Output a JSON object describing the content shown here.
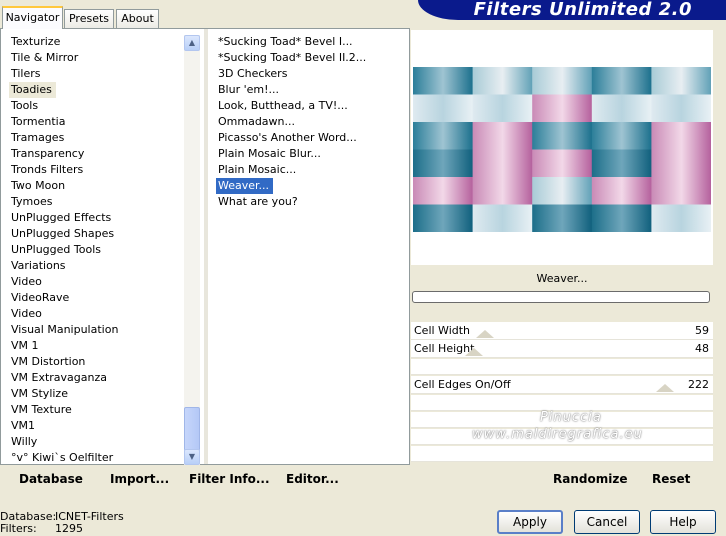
{
  "tabs": [
    {
      "label": "Navigator",
      "active": true
    },
    {
      "label": "Presets",
      "active": false
    },
    {
      "label": "About",
      "active": false
    }
  ],
  "banner": {
    "title": "Filters Unlimited 2.0",
    "color": "#0a1a8c"
  },
  "categories": {
    "items": [
      "Texturize",
      "Tile & Mirror",
      "Tilers",
      "Toadies",
      "Tools",
      "Tormentia",
      "Tramages",
      "Transparency",
      "Tronds Filters",
      "Two Moon",
      "Tymoes",
      "UnPlugged Effects",
      "UnPlugged Shapes",
      "UnPlugged Tools",
      "Variations",
      "Video",
      "VideoRave",
      "Video",
      "Visual Manipulation",
      "VM 1",
      "VM Distortion",
      "VM Extravaganza",
      "VM Stylize",
      "VM Texture",
      "VM1",
      "Willy",
      "°v° Kiwi`s Oelfilter"
    ],
    "selected": "Toadies"
  },
  "filters": {
    "items": [
      "*Sucking Toad*  Bevel I...",
      "*Sucking Toad*  Bevel II.2...",
      "3D Checkers",
      "Blur 'em!...",
      "Look, Butthead, a TV!...",
      "Ommadawn...",
      "Picasso's Another Word...",
      "Plain Mosaic Blur...",
      "Plain Mosaic...",
      "Weaver...",
      "What are you?"
    ],
    "selected": "Weaver...",
    "selected_color": "#316ac5"
  },
  "buttons": {
    "database": "Database",
    "import": "Import...",
    "filter_info": "Filter Info...",
    "editor": "Editor...",
    "randomize": "Randomize",
    "reset": "Reset",
    "apply": "Apply",
    "cancel": "Cancel",
    "help": "Help"
  },
  "preview": {
    "filter_name": "Weaver...",
    "progress": 0
  },
  "sliders": [
    {
      "label": "Cell Width",
      "value": "59",
      "level": 0.23
    },
    {
      "label": "Cell Height",
      "value": "48",
      "level": 0.19
    },
    {
      "label": "Cell Edges On/Off",
      "value": "222",
      "level": 0.87
    }
  ],
  "watermark": {
    "line1": "Pinuccia",
    "line2": "www.maldiregrafica.eu"
  },
  "status": {
    "database_label": "Database:",
    "database_value": "ICNET-Filters",
    "filters_label": "Filters:",
    "filters_value": "1295"
  }
}
